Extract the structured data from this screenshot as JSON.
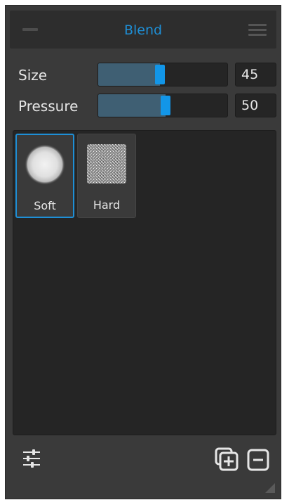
{
  "panel": {
    "title": "Blend"
  },
  "controls": {
    "size": {
      "label": "Size",
      "value": "45",
      "level": 45
    },
    "pressure": {
      "label": "Pressure",
      "value": "50",
      "level": 50
    }
  },
  "brushes": [
    {
      "label": "Soft",
      "selected": true
    },
    {
      "label": "Hard",
      "selected": false
    }
  ],
  "footer": {
    "settings_icon": "sliders-icon",
    "duplicate_icon": "duplicate-add-icon",
    "remove_icon": "remove-icon"
  },
  "colors": {
    "accent": "#1e8fd6",
    "slider_thumb": "#1296e8",
    "slider_fill": "#3f5f73",
    "panel_bg": "#3a3a3a",
    "well_bg": "#252525",
    "text": "#e6e6e6"
  }
}
